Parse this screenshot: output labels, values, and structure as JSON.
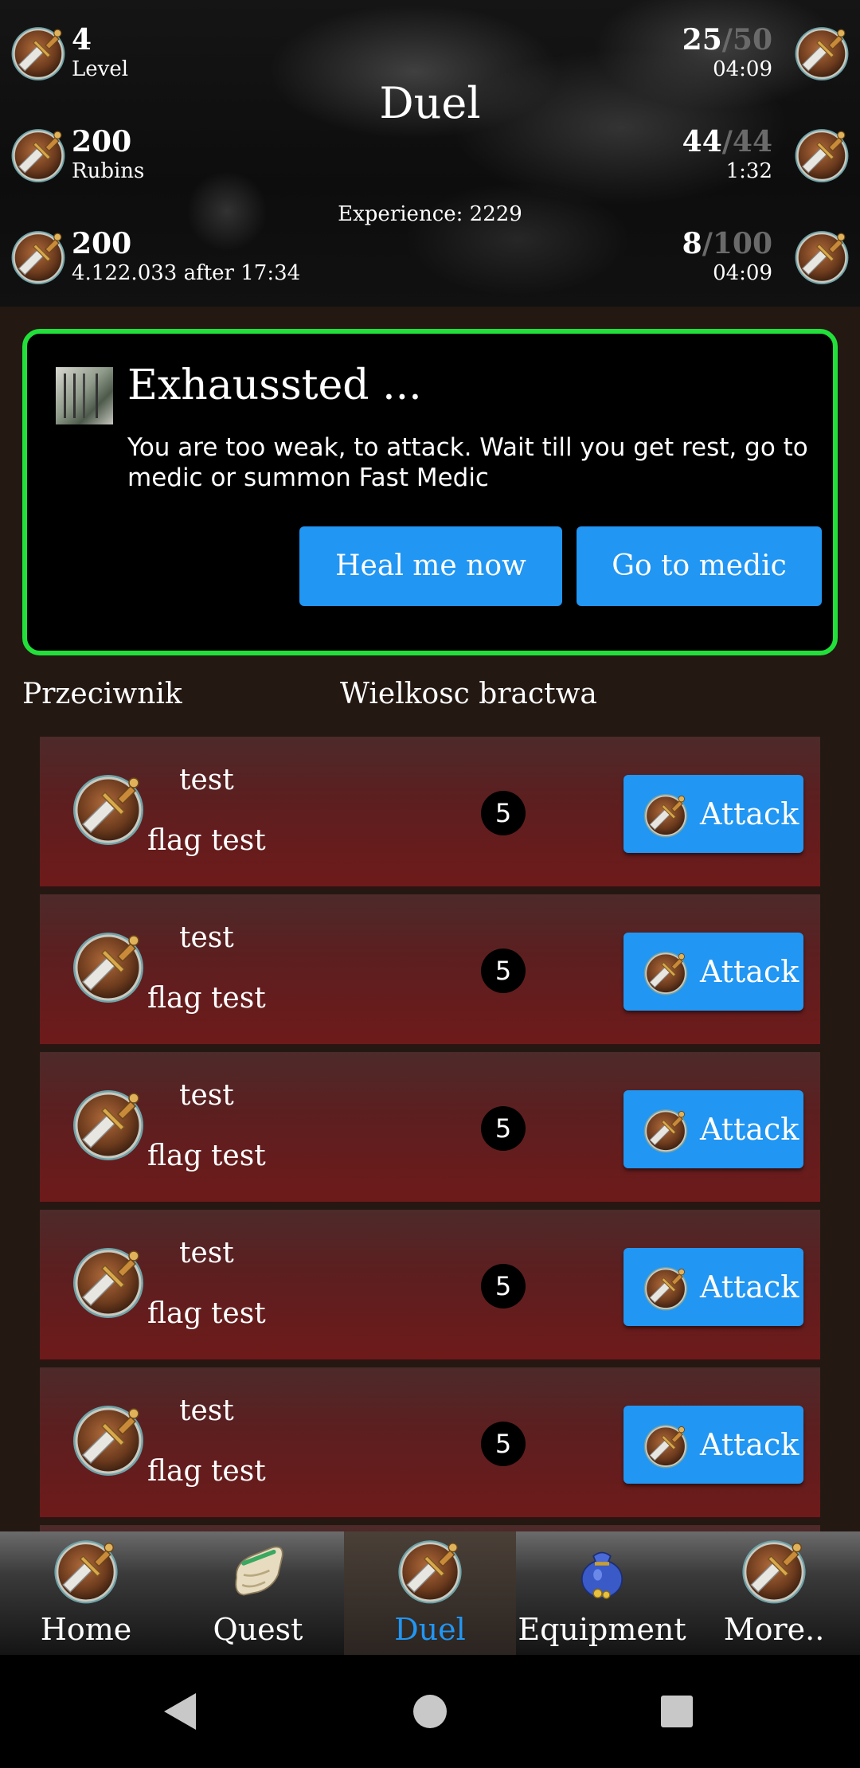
{
  "header": {
    "title": "Duel",
    "experience": "Experience: 2229",
    "left_stats": [
      {
        "value": "4",
        "label": "Level"
      },
      {
        "value": "200",
        "label": "Rubins"
      },
      {
        "value": "200",
        "label": "4.122.033 after 17:34"
      }
    ],
    "right_stats": [
      {
        "current": "25",
        "max": "/50",
        "timer": "04:09"
      },
      {
        "current": "44",
        "max": "/44",
        "timer": "1:32"
      },
      {
        "current": "8",
        "max": "/100",
        "timer": "04:09"
      }
    ]
  },
  "alert": {
    "title": "Exhaussted ...",
    "message": "You are too weak, to attack. Wait till you get rest, go to medic or summon Fast Medic",
    "heal_button": "Heal me now",
    "medic_button": "Go to medic"
  },
  "columns": {
    "opponent": "Przeciwnik",
    "brotherhood_size": "Wielkosc bractwa"
  },
  "opponents": [
    {
      "name": "test",
      "flag": "flag test",
      "count": "5",
      "action": "Attack"
    },
    {
      "name": "test",
      "flag": "flag test",
      "count": "5",
      "action": "Attack"
    },
    {
      "name": "test",
      "flag": "flag test",
      "count": "5",
      "action": "Attack"
    },
    {
      "name": "test",
      "flag": "flag test",
      "count": "5",
      "action": "Attack"
    },
    {
      "name": "test",
      "flag": "flag test",
      "count": "5",
      "action": "Attack"
    }
  ],
  "bottom_nav": [
    {
      "label": "Home",
      "icon": "sword-shield-icon"
    },
    {
      "label": "Quest",
      "icon": "scroll-icon"
    },
    {
      "label": "Duel",
      "icon": "sword-shield-icon",
      "active": true
    },
    {
      "label": "Equipment",
      "icon": "money-bag-icon"
    },
    {
      "label": "More..",
      "icon": "sword-shield-icon"
    }
  ],
  "colors": {
    "accent_blue": "#2196f3",
    "alert_border": "#22e03a",
    "row_red": "#6e1a1a",
    "background": "#241812"
  }
}
